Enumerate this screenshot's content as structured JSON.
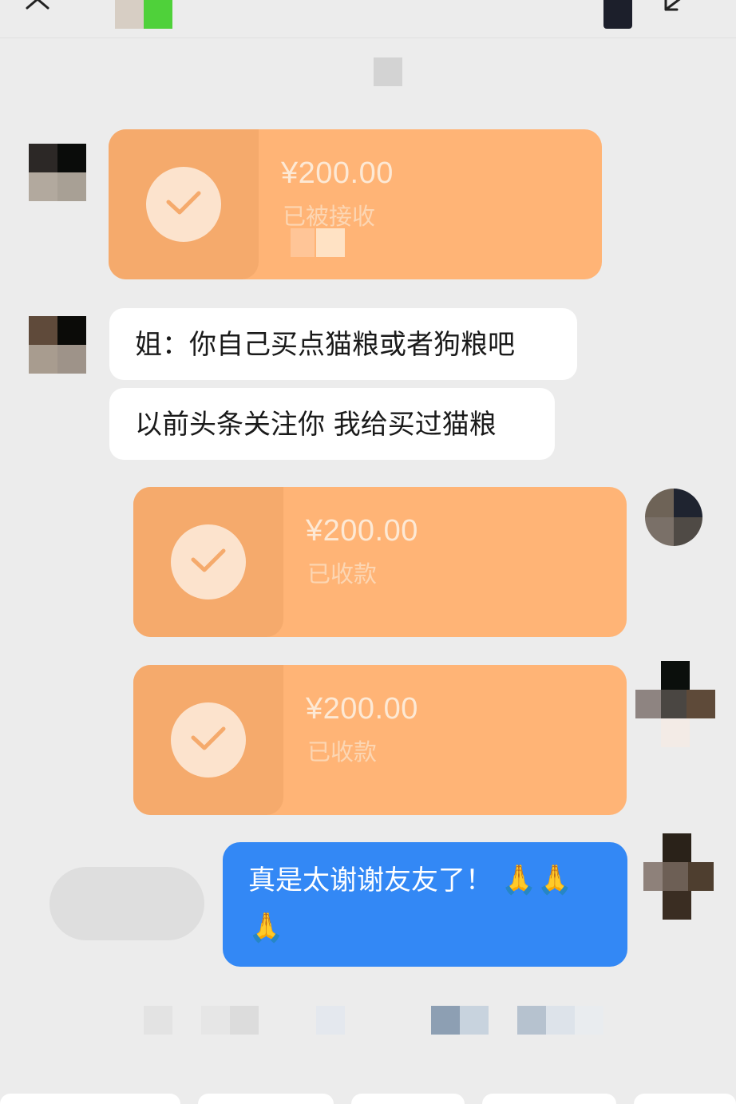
{
  "colors": {
    "background": "#ececec",
    "transfer_card": "#ffb476",
    "sent_bubble": "#3388f5",
    "received_bubble": "#ffffff"
  },
  "icons": {
    "close": "close-icon",
    "shrink": "shrink-icon",
    "check": "check-icon"
  },
  "messages": {
    "transfer_1": {
      "amount": "¥200.00",
      "status": "已被接收"
    },
    "text_1": "姐：你自己买点猫粮或者狗粮吧",
    "text_2": "以前头条关注你 我给买过猫粮",
    "transfer_2": {
      "amount": "¥200.00",
      "status": "已收款"
    },
    "transfer_3": {
      "amount": "¥200.00",
      "status": "已收款"
    },
    "text_3": "真是太谢谢友友了！",
    "text_3_emoji_line1": "🙏🙏",
    "text_3_emoji_line2": "🙏"
  }
}
